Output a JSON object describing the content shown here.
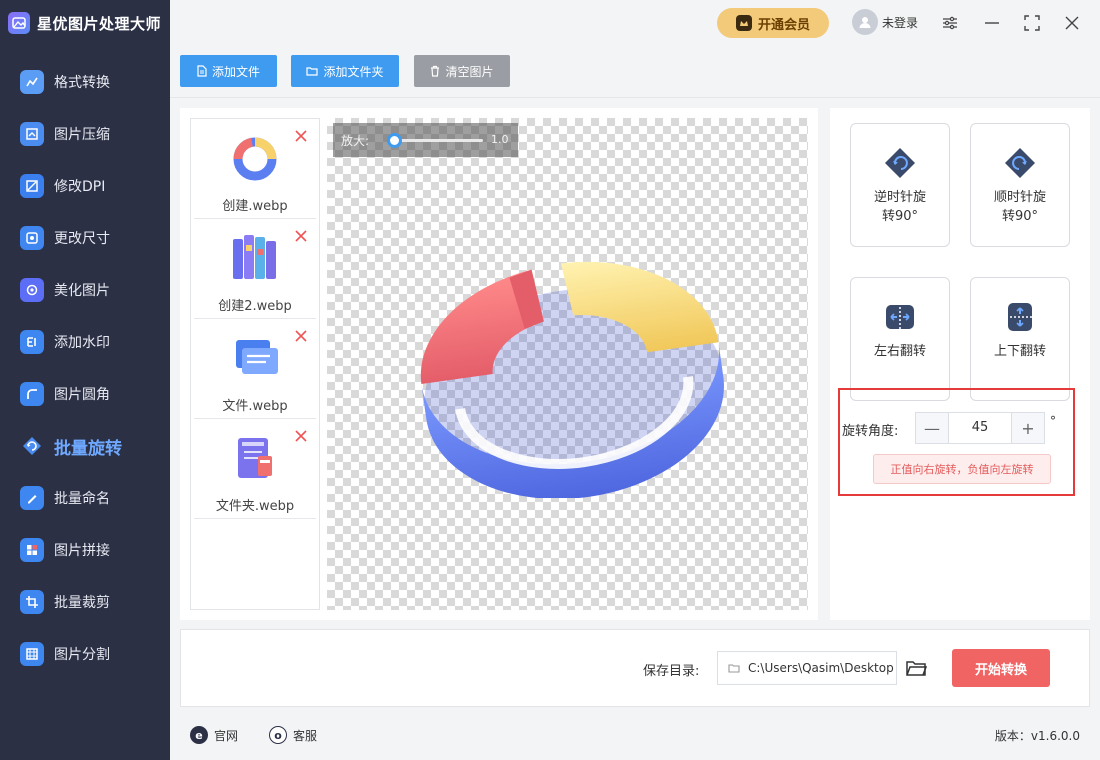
{
  "app": {
    "title": "星优图片处理大师"
  },
  "sidebar": {
    "items": [
      {
        "label": "格式转换",
        "icon": "format-convert-icon",
        "color": "#5b9cf5"
      },
      {
        "label": "图片压缩",
        "icon": "image-compress-icon",
        "color": "#4a8cf0"
      },
      {
        "label": "修改DPI",
        "icon": "dpi-icon",
        "color": "#3b7fee"
      },
      {
        "label": "更改尺寸",
        "icon": "resize-icon",
        "color": "#3f86f0"
      },
      {
        "label": "美化图片",
        "icon": "beautify-icon",
        "color": "#5b6ef5"
      },
      {
        "label": "添加水印",
        "icon": "watermark-icon",
        "color": "#3e86f0"
      },
      {
        "label": "图片圆角",
        "icon": "rounded-corner-icon",
        "color": "#3e86f0"
      },
      {
        "label": "批量旋转",
        "icon": "rotate-icon",
        "color": "#6ea8ff",
        "active": true
      },
      {
        "label": "批量命名",
        "icon": "rename-icon",
        "color": "#3e86f0"
      },
      {
        "label": "图片拼接",
        "icon": "stitch-icon",
        "color": "#3e86f0"
      },
      {
        "label": "批量裁剪",
        "icon": "crop-icon",
        "color": "#3e86f0"
      },
      {
        "label": "图片分割",
        "icon": "split-icon",
        "color": "#3e86f0"
      }
    ]
  },
  "topbar": {
    "vip_label": "开通会员",
    "user_label": "未登录"
  },
  "toolbar": {
    "add_file": "添加文件",
    "add_folder": "添加文件夹",
    "clear": "清空图片"
  },
  "files": [
    {
      "name": "创建.webp",
      "thumb": "donut-chart-thumb"
    },
    {
      "name": "创建2.webp",
      "thumb": "books-thumb"
    },
    {
      "name": "文件.webp",
      "thumb": "document-thumb"
    },
    {
      "name": "文件夹.webp",
      "thumb": "folder-thumb"
    }
  ],
  "preview": {
    "zoom_label": "放大:",
    "zoom_value": "1.0"
  },
  "rotate": {
    "ccw_line1": "逆时针旋",
    "ccw_line2": "转90°",
    "cw_line1": "顺时针旋",
    "cw_line2": "转90°",
    "flip_h": "左右翻转",
    "flip_v": "上下翻转",
    "angle_label": "旋转角度:",
    "angle_value": "45",
    "degree": "°",
    "minus": "—",
    "plus": "+",
    "hint": "正值向右旋转，负值向左旋转"
  },
  "bottom": {
    "save_label": "保存目录:",
    "save_path": "C:\\Users\\Qasim\\Desktop",
    "start": "开始转换"
  },
  "footer": {
    "website": "官网",
    "service": "客服",
    "version": "版本：v1.6.0.0"
  },
  "colors": {
    "sidebar_bg": "#2b3045",
    "accent_blue": "#3e9bf0",
    "start_red": "#f06464",
    "vip_gold": "#f3c97a"
  }
}
